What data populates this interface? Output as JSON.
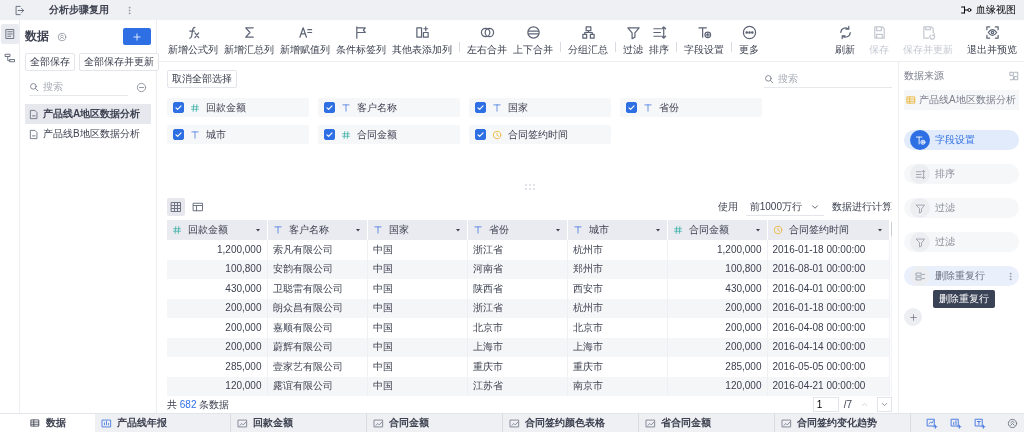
{
  "top_bar": {
    "title": "分析步骤复用",
    "lineage_button": "血缘视图"
  },
  "rail": [
    {
      "kind": "datalist",
      "selected": true
    },
    {
      "kind": "flow",
      "selected": false
    }
  ],
  "data_panel": {
    "title": "数据",
    "buttons": [
      "全部保存",
      "全部保存并更新"
    ],
    "search": {
      "placeholder": "搜索"
    },
    "items": [
      {
        "label": "产品线A地区数据分析",
        "selected": true
      },
      {
        "label": "产品线B地区数据分析",
        "selected": false
      }
    ]
  },
  "toolbar": {
    "groups": [
      [
        {
          "kind": "formula",
          "label": "新增公式列"
        },
        {
          "kind": "sum",
          "label": "新增汇总列"
        },
        {
          "kind": "assign",
          "label": "新增赋值列"
        },
        {
          "kind": "tag",
          "label": "条件标签列"
        },
        {
          "kind": "addtable",
          "label": "其他表添加列"
        }
      ],
      [
        {
          "kind": "joinlr",
          "label": "左右合并"
        },
        {
          "kind": "joinud",
          "label": "上下合并"
        }
      ],
      [
        {
          "kind": "group",
          "label": "分组汇总"
        }
      ],
      [
        {
          "kind": "filter",
          "label": "过滤"
        },
        {
          "kind": "sort",
          "label": "排序"
        }
      ],
      [
        {
          "kind": "fieldset",
          "label": "字段设置"
        }
      ],
      [
        {
          "kind": "more",
          "label": "更多"
        }
      ]
    ],
    "right": [
      {
        "kind": "refresh",
        "label": "刷新",
        "disabled": false
      },
      {
        "kind": "save",
        "label": "保存",
        "disabled": true
      },
      {
        "kind": "saveupdate",
        "label": "保存并更新",
        "disabled": true
      },
      {
        "kind": "preview",
        "label": "退出并预览",
        "disabled": false
      }
    ]
  },
  "field_picker": {
    "deselect_button": "取消全部选择",
    "search": {
      "placeholder": "搜索"
    },
    "fields": [
      {
        "name": "回款金额",
        "kind": "number",
        "checked": true
      },
      {
        "name": "客户名称",
        "kind": "text",
        "checked": true
      },
      {
        "name": "国家",
        "kind": "text",
        "checked": true
      },
      {
        "name": "省份",
        "kind": "text",
        "checked": true
      },
      {
        "name": "城市",
        "kind": "text",
        "checked": true
      },
      {
        "name": "合同金额",
        "kind": "number",
        "checked": true
      },
      {
        "name": "合同签约时间",
        "kind": "date",
        "checked": true
      }
    ]
  },
  "views": [
    {
      "kind": "table",
      "selected": true
    },
    {
      "kind": "layout",
      "selected": false
    }
  ],
  "row_limit": {
    "prefix": "使用",
    "value": "前1000万行",
    "suffix": "数据进行计算"
  },
  "table": {
    "columns": [
      {
        "name": "回款金额",
        "kind": "number"
      },
      {
        "name": "客户名称",
        "kind": "text"
      },
      {
        "name": "国家",
        "kind": "text"
      },
      {
        "name": "省份",
        "kind": "text"
      },
      {
        "name": "城市",
        "kind": "text"
      },
      {
        "name": "合同金额",
        "kind": "number"
      },
      {
        "name": "合同签约时间",
        "kind": "date"
      }
    ],
    "rows": [
      [
        "1,200,000",
        "索凡有限公司",
        "中国",
        "浙江省",
        "杭州市",
        "1,200,000",
        "2016-01-18 00:00:00"
      ],
      [
        "100,800",
        "安韵有限公司",
        "中国",
        "河南省",
        "郑州市",
        "100,800",
        "2016-08-01 00:00:00"
      ],
      [
        "430,000",
        "卫聪雷有限公司",
        "中国",
        "陕西省",
        "西安市",
        "430,000",
        "2016-04-01 00:00:00"
      ],
      [
        "200,000",
        "朗众昌有限公司",
        "中国",
        "浙江省",
        "杭州市",
        "200,000",
        "2016-01-18 00:00:00"
      ],
      [
        "200,000",
        "嘉顺有限公司",
        "中国",
        "北京市",
        "北京市",
        "200,000",
        "2016-04-08 00:00:00"
      ],
      [
        "200,000",
        "蔚辉有限公司",
        "中国",
        "上海市",
        "上海市",
        "200,000",
        "2016-04-14 00:00:00"
      ],
      [
        "285,000",
        "壹家艺有限公司",
        "中国",
        "重庆市",
        "重庆市",
        "285,000",
        "2016-05-05 00:00:00"
      ],
      [
        "120,000",
        "露谊有限公司",
        "中国",
        "江苏省",
        "南京市",
        "120,000",
        "2016-04-21 00:00:00"
      ]
    ]
  },
  "footer": {
    "prefix": "共",
    "count": "682",
    "suffix": "条数据"
  },
  "pagination": {
    "page": "1",
    "total": "/7"
  },
  "process": {
    "title": "数据来源",
    "source": "产品线A地区数据分析",
    "tooltip": "删除重复行",
    "steps": [
      {
        "kind": "fieldset",
        "label": "字段设置",
        "selected": true,
        "hovered": false
      },
      {
        "kind": "sort",
        "label": "排序",
        "selected": false,
        "hovered": false
      },
      {
        "kind": "filter",
        "label": "过滤",
        "selected": false,
        "hovered": false
      },
      {
        "kind": "filter",
        "label": "过滤",
        "selected": false,
        "hovered": false
      },
      {
        "kind": "dedupe",
        "label": "删除重复行",
        "selected": false,
        "hovered": true
      }
    ]
  },
  "bottom_bar": {
    "data_tab": "数据",
    "tabs": [
      {
        "kind": "report",
        "label": "产品线年报"
      },
      {
        "kind": "chart",
        "label": "回款金额"
      },
      {
        "kind": "chart",
        "label": "合同金额"
      },
      {
        "kind": "chart",
        "label": "合同签约颜色表格"
      },
      {
        "kind": "chart",
        "label": "省合同金额"
      },
      {
        "kind": "chart",
        "label": "合同签约变化趋势"
      }
    ]
  }
}
